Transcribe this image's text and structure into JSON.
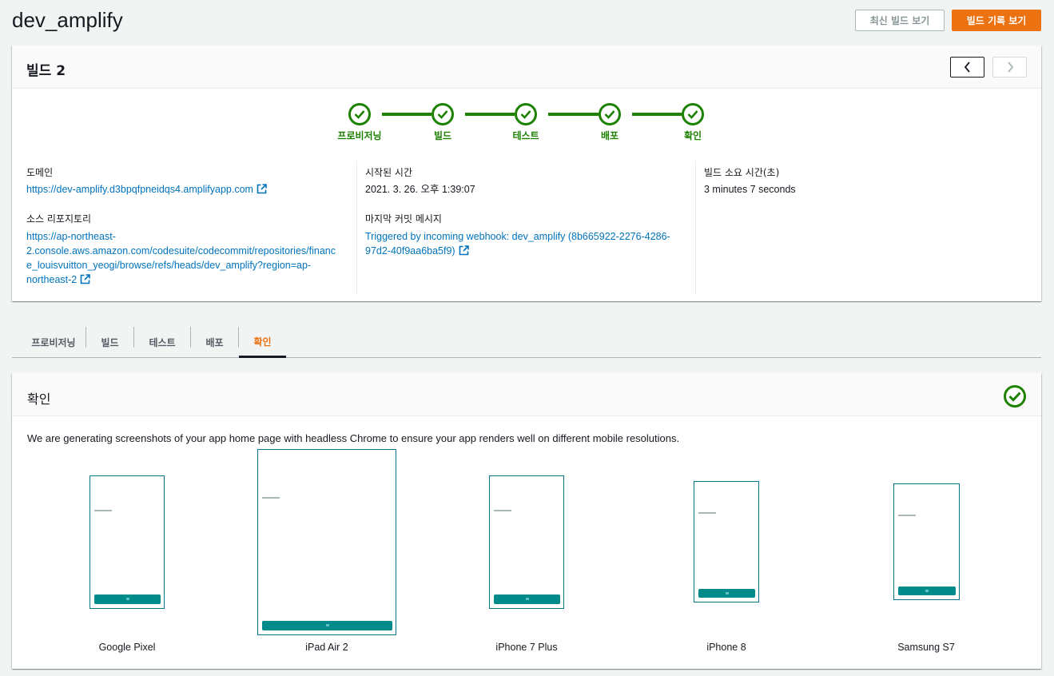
{
  "app": {
    "title": "dev_amplify"
  },
  "header": {
    "latest_build_label": "최신 빌드 보기",
    "history_label": "빌드 기록 보기"
  },
  "build": {
    "title": "빌드 2",
    "steps": [
      "프로비저닝",
      "빌드",
      "테스트",
      "배포",
      "확인"
    ],
    "domain_label": "도메인",
    "domain_value": "https://dev-amplify.d3bpqfpneidqs4.amplifyapp.com",
    "repo_label": "소스 리포지토리",
    "repo_lines": [
      "https://ap-northeast-",
      "2.console.aws.amazon.com/codesuite/codecommit/repositories/financ",
      "e_louisvuitton_yeogi/browse/refs/heads/dev_amplify?region=ap-",
      "northeast-2"
    ],
    "started_label": "시작된 시간",
    "started_value": "2021. 3. 26. 오후 1:39:07",
    "commit_label": "마지막 커밋 메시지",
    "commit_lines": [
      "Triggered by incoming webhook: dev_amplify (8b665922-2276-4286-",
      "97d2-40f9aa6ba5f9)"
    ],
    "duration_label": "빌드 소요 시간(초)",
    "duration_value": "3 minutes 7 seconds"
  },
  "tabs": [
    "프로비저닝",
    "빌드",
    "테스트",
    "배포",
    "확인"
  ],
  "active_tab": "확인",
  "verify": {
    "title": "확인",
    "description": "We are generating screenshots of your app home page with headless Chrome to ensure your app renders well on different mobile resolutions.",
    "devices": [
      "Google Pixel",
      "iPad Air 2",
      "iPhone 7 Plus",
      "iPhone 8",
      "Samsung S7"
    ]
  },
  "colors": {
    "accent": "#ec7211",
    "success": "#1d8102",
    "link": "#0073bb",
    "device_bar": "#008a8a"
  },
  "icons": {
    "prev": "chevron-left-icon",
    "next": "chevron-right-icon",
    "step": "check-circle-icon",
    "external": "external-link-icon"
  }
}
